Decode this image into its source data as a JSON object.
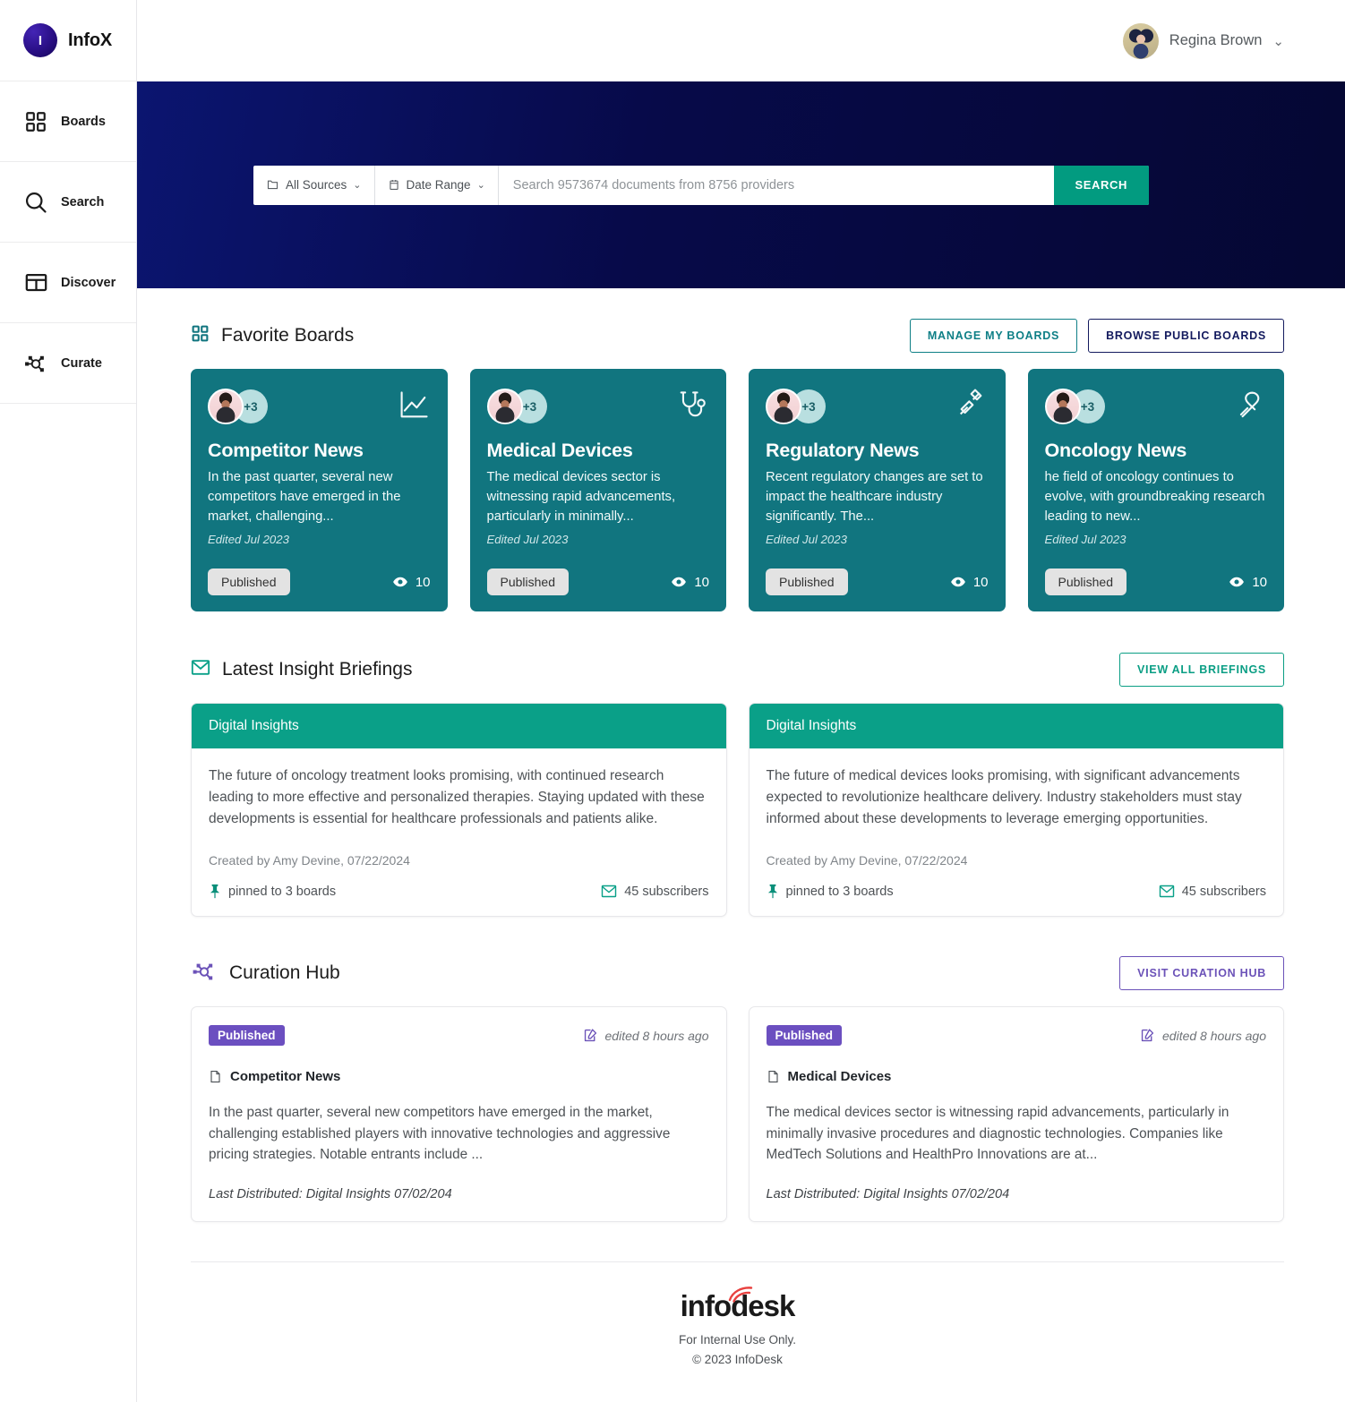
{
  "brand": {
    "logo_letter": "I",
    "name": "InfoX"
  },
  "sidebar": {
    "items": [
      {
        "label": "Boards",
        "icon": "grid-icon"
      },
      {
        "label": "Search",
        "icon": "search-icon"
      },
      {
        "label": "Discover",
        "icon": "layout-icon"
      },
      {
        "label": "Curate",
        "icon": "network-icon"
      }
    ]
  },
  "topbar": {
    "user_name": "Regina Brown",
    "caret": "⌄"
  },
  "search": {
    "sources_label": "All Sources",
    "date_label": "Date Range",
    "placeholder": "Search 9573674 documents from 8756 providers",
    "value": "",
    "button": "SEARCH",
    "chevron": "⌄"
  },
  "favorite_boards": {
    "title": "Favorite Boards",
    "manage_label": "MANAGE MY BOARDS",
    "browse_label": "BROWSE PUBLIC BOARDS",
    "cards": [
      {
        "avatar_more": "+3",
        "icon": "line-chart-icon",
        "title": "Competitor News",
        "description": " In the past quarter, several new competitors have emerged in the market, challenging...",
        "edited": "Edited Jul 2023",
        "status": "Published",
        "views": "10"
      },
      {
        "avatar_more": "+3",
        "icon": "stethoscope-icon",
        "title": "Medical Devices",
        "description": "The medical devices sector is witnessing rapid advancements, particularly in minimally...",
        "edited": "Edited Jul 2023",
        "status": "Published",
        "views": "10"
      },
      {
        "avatar_more": "+3",
        "icon": "gavel-icon",
        "title": "Regulatory News",
        "description": "Recent regulatory changes are set to impact the healthcare industry significantly. The...",
        "edited": "Edited Jul 2023",
        "status": "Published",
        "views": "10"
      },
      {
        "avatar_more": "+3",
        "icon": "ribbon-icon",
        "title": "Oncology News",
        "description": "he field of oncology continues to evolve, with groundbreaking research leading to new...",
        "edited": "Edited Jul 2023",
        "status": "Published",
        "views": "10"
      }
    ]
  },
  "briefings": {
    "title": "Latest Insight Briefings",
    "view_all_label": "VIEW ALL BRIEFINGS",
    "cards": [
      {
        "header": "Digital Insights",
        "text": "The future of oncology treatment looks promising, with continued research leading to more effective and personalized therapies. Staying updated with these developments is essential for healthcare professionals and patients alike.",
        "created": "Created by Amy Devine, 07/22/2024",
        "pinned": "pinned to 3 boards",
        "subscribers": "45 subscribers"
      },
      {
        "header": "Digital Insights",
        "text": "The future of medical devices looks promising, with significant advancements expected to revolutionize healthcare delivery. Industry stakeholders must stay informed about these developments to leverage emerging opportunities.",
        "created": "Created by Amy Devine, 07/22/2024",
        "pinned": "pinned to 3 boards",
        "subscribers": "45 subscribers"
      }
    ]
  },
  "curation": {
    "title": "Curation Hub",
    "visit_label": "VISIT CURATION HUB",
    "cards": [
      {
        "status": "Published",
        "edited": "edited 8 hours ago",
        "board": "Competitor News",
        "text": "In the past quarter, several new competitors have emerged in the market, challenging established players with innovative technologies and aggressive pricing strategies. Notable entrants include ...",
        "distributed": "Last Distributed: Digital Insights 07/02/204"
      },
      {
        "status": "Published",
        "edited": "edited 8 hours ago",
        "board": "Medical Devices",
        "text": "The medical devices sector is witnessing rapid advancements, particularly in minimally invasive procedures and diagnostic technologies. Companies like MedTech Solutions and HealthPro Innovations are at...",
        "distributed": "Last Distributed: Digital Insights 07/02/204"
      }
    ]
  },
  "footer": {
    "logo_pre": "inf",
    "logo_o": "o",
    "logo_post": "desk",
    "line1": "For Internal Use Only.",
    "line2": "© 2023 InfoDesk"
  },
  "colors": {
    "hero_navy": "#070a49",
    "teal_card": "#11757f",
    "green_accent": "#0aa088",
    "search_green": "#029b80",
    "purple": "#6b4fc0",
    "navy_text": "#131a5e"
  }
}
